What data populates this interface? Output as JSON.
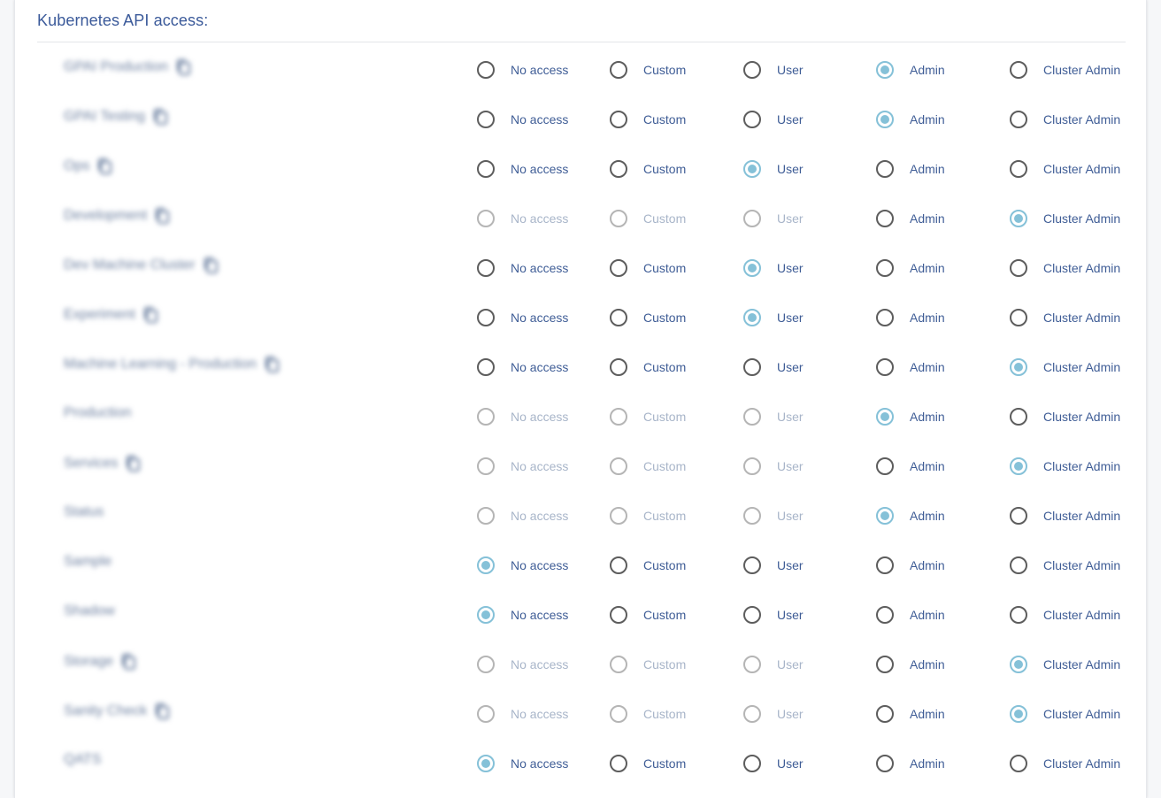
{
  "section": {
    "title": "Kubernetes API access:"
  },
  "options": [
    "No access",
    "Custom",
    "User",
    "Admin",
    "Cluster Admin"
  ],
  "colors": {
    "title": "#3b5a9a",
    "label": "#3f5d96",
    "label_disabled": "#a8b5c9",
    "radio_checked": "#85c1d8",
    "radio_border": "#5d5d5d",
    "radio_border_disabled": "#b5b5b5"
  },
  "rows": [
    {
      "name": "GPAI Production",
      "copy_icon": true,
      "selected": 3,
      "disabled": []
    },
    {
      "name": "GPAI Testing",
      "copy_icon": true,
      "selected": 3,
      "disabled": []
    },
    {
      "name": "Ops",
      "copy_icon": true,
      "selected": 2,
      "disabled": []
    },
    {
      "name": "Development",
      "copy_icon": true,
      "selected": 4,
      "disabled": [
        0,
        1,
        2
      ]
    },
    {
      "name": "Dev Machine Cluster",
      "copy_icon": true,
      "selected": 2,
      "disabled": []
    },
    {
      "name": "Experiment",
      "copy_icon": true,
      "selected": 2,
      "disabled": []
    },
    {
      "name": "Machine Learning - Production",
      "copy_icon": true,
      "selected": 4,
      "disabled": []
    },
    {
      "name": "Production",
      "copy_icon": false,
      "selected": 3,
      "disabled": [
        0,
        1,
        2
      ]
    },
    {
      "name": "Services",
      "copy_icon": true,
      "selected": 4,
      "disabled": [
        0,
        1,
        2
      ]
    },
    {
      "name": "Status",
      "copy_icon": false,
      "selected": 3,
      "disabled": [
        0,
        1,
        2
      ]
    },
    {
      "name": "Sample",
      "copy_icon": false,
      "selected": 0,
      "disabled": []
    },
    {
      "name": "Shadow",
      "copy_icon": false,
      "selected": 0,
      "disabled": []
    },
    {
      "name": "Storage",
      "copy_icon": true,
      "selected": 4,
      "disabled": [
        0,
        1,
        2
      ]
    },
    {
      "name": "Sanity Check",
      "copy_icon": true,
      "selected": 4,
      "disabled": [
        0,
        1,
        2
      ]
    },
    {
      "name": "QATS",
      "copy_icon": false,
      "selected": 0,
      "disabled": []
    }
  ]
}
